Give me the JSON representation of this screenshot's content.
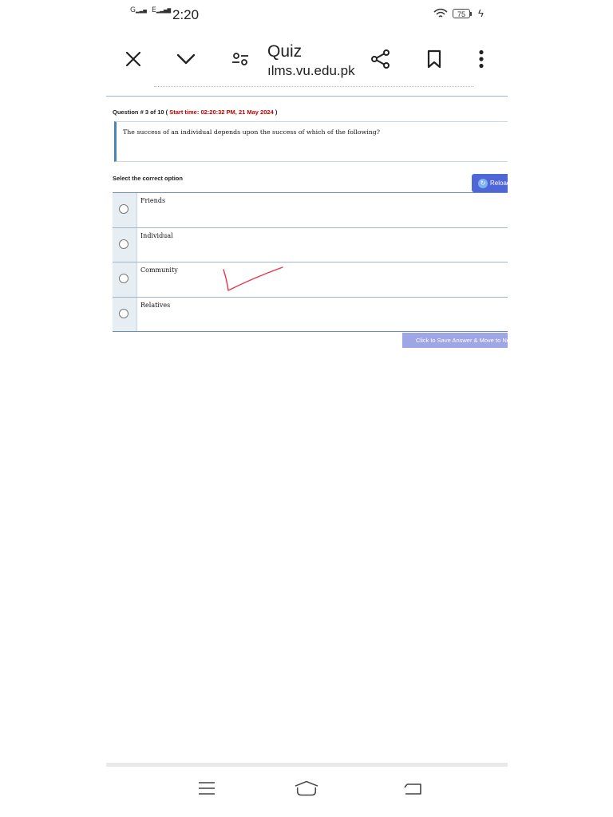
{
  "status_bar": {
    "signal_1_label": "G",
    "signal_2_label": "E",
    "time": "2:20",
    "battery": "75"
  },
  "toolbar": {
    "title": "Quiz",
    "url": "ılms.vu.edu.pk",
    "icons": [
      "close-icon",
      "chevron-down-icon",
      "tune-icon",
      "share-icon",
      "bookmark-icon",
      "more-vert-icon"
    ]
  },
  "quiz": {
    "question_prefix": "Question # 3 of 10 ( ",
    "start_time": "Start time: 02:20:32 PM, 21 May 2024",
    "question_suffix": " )",
    "question_text": "The success of an individual depends upon the success of which of the following?",
    "select_label": "Select the correct option",
    "reload_label": "Reload",
    "options": [
      "Friends",
      "Individual",
      "Community",
      "Relatives"
    ],
    "save_label": "Click to Save Answer & Move to Next Question"
  },
  "colors": {
    "accent": "#4e66d6",
    "time_red": "#c00000",
    "check_mark": "#e8334a"
  }
}
